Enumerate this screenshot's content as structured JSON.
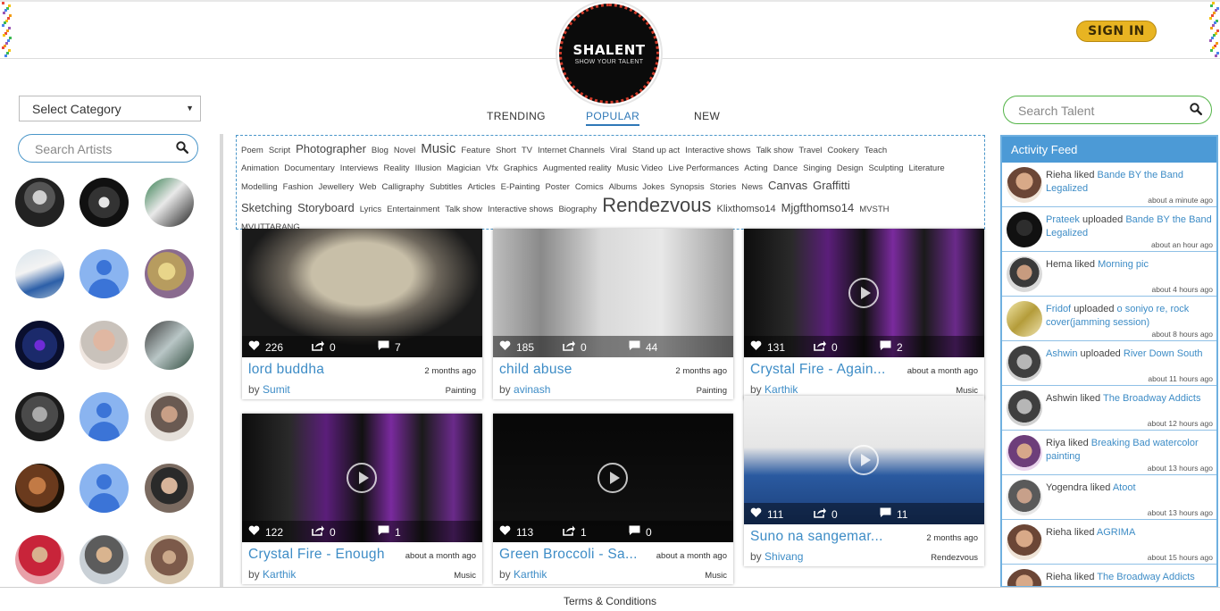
{
  "header": {
    "brand": "SHALENT",
    "tagline": "SHOW YOUR TALENT",
    "signin_label": "SIGN IN"
  },
  "left": {
    "category_select": "Select Category",
    "artist_search_placeholder": "Search Artists"
  },
  "tabs": [
    {
      "label": "TRENDING",
      "active": false
    },
    {
      "label": "POPULAR",
      "active": true
    },
    {
      "label": "NEW",
      "active": false
    }
  ],
  "tags": [
    {
      "t": "Poem",
      "s": 1
    },
    {
      "t": "Script",
      "s": 1
    },
    {
      "t": "Photographer",
      "s": 2
    },
    {
      "t": "Blog",
      "s": 1
    },
    {
      "t": "Novel",
      "s": 1
    },
    {
      "t": "Music",
      "s": 3
    },
    {
      "t": "Feature",
      "s": 1
    },
    {
      "t": "Short",
      "s": 1
    },
    {
      "t": "TV",
      "s": 1
    },
    {
      "t": "Internet Channels",
      "s": 1
    },
    {
      "t": "Viral",
      "s": 1
    },
    {
      "t": "Stand up act",
      "s": 1
    },
    {
      "t": "Interactive shows",
      "s": 1
    },
    {
      "t": "Talk show",
      "s": 1
    },
    {
      "t": "Travel",
      "s": 1
    },
    {
      "t": "Cookery",
      "s": 1
    },
    {
      "t": "Teach",
      "s": 1
    },
    {
      "t": "Animation",
      "s": 1
    },
    {
      "t": "Documentary",
      "s": 1
    },
    {
      "t": "Interviews",
      "s": 1
    },
    {
      "t": "Reality",
      "s": 1
    },
    {
      "t": "Illusion",
      "s": 1
    },
    {
      "t": "Magician",
      "s": 1
    },
    {
      "t": "Vfx",
      "s": 1
    },
    {
      "t": "Graphics",
      "s": 1
    },
    {
      "t": "Augmented reality",
      "s": 1
    },
    {
      "t": "Music Video",
      "s": 1
    },
    {
      "t": "Live Performances",
      "s": 1
    },
    {
      "t": "Acting",
      "s": 1
    },
    {
      "t": "Dance",
      "s": 1
    },
    {
      "t": "Singing",
      "s": 1
    },
    {
      "t": "Design",
      "s": 1
    },
    {
      "t": "Sculpting",
      "s": 1
    },
    {
      "t": "Literature",
      "s": 1
    },
    {
      "t": "Modelling",
      "s": 1
    },
    {
      "t": "Fashion",
      "s": 1
    },
    {
      "t": "Jewellery",
      "s": 1
    },
    {
      "t": "Web",
      "s": 1
    },
    {
      "t": "Calligraphy",
      "s": 1
    },
    {
      "t": "Subtitles",
      "s": 1
    },
    {
      "t": "Articles",
      "s": 1
    },
    {
      "t": "E-Painting",
      "s": 1
    },
    {
      "t": "Poster",
      "s": 1
    },
    {
      "t": "Comics",
      "s": 1
    },
    {
      "t": "Albums",
      "s": 1
    },
    {
      "t": "Jokes",
      "s": 1
    },
    {
      "t": "Synopsis",
      "s": 1
    },
    {
      "t": "Stories",
      "s": 1
    },
    {
      "t": "News",
      "s": 1
    },
    {
      "t": "Canvas",
      "s": 2
    },
    {
      "t": "Graffitti",
      "s": 2
    },
    {
      "t": "Sketching",
      "s": 2
    },
    {
      "t": "Storyboard",
      "s": 2
    },
    {
      "t": "Lyrics",
      "s": 1
    },
    {
      "t": "Entertainment",
      "s": 1
    },
    {
      "t": "Talk show",
      "s": 1
    },
    {
      "t": "Interactive shows",
      "s": 1
    },
    {
      "t": "Biography",
      "s": 1
    },
    {
      "t": "Rendezvous",
      "s": 4
    },
    {
      "t": "Klixthomso14",
      "s": 1.5
    },
    {
      "t": "Mjgfthomso14",
      "s": 2
    },
    {
      "t": "MVSTH",
      "s": 1
    },
    {
      "t": "MVUTTARANG",
      "s": 1
    }
  ],
  "cards": [
    {
      "title": "lord buddha",
      "ago": "2 months ago",
      "by_prefix": "by",
      "author": "Sumit",
      "category": "Painting",
      "likes": "226",
      "shares": "0",
      "comments": "7",
      "video": false,
      "thumb": "buddha"
    },
    {
      "title": "child abuse",
      "ago": "2 months ago",
      "by_prefix": "by",
      "author": "avinash",
      "category": "Painting",
      "likes": "185",
      "shares": "0",
      "comments": "44",
      "video": false,
      "thumb": "childabuse"
    },
    {
      "title": "Crystal Fire - Again...",
      "ago": "about a month ago",
      "by_prefix": "by",
      "author": "Karthik",
      "category": "Music",
      "likes": "131",
      "shares": "0",
      "comments": "2",
      "video": true,
      "thumb": "concert"
    },
    {
      "title": "Crystal Fire - Enough",
      "ago": "about a month ago",
      "by_prefix": "by",
      "author": "Karthik",
      "category": "Music",
      "likes": "122",
      "shares": "0",
      "comments": "1",
      "video": true,
      "thumb": "concert"
    },
    {
      "title": "Green Broccoli - Sa...",
      "ago": "about a month ago",
      "by_prefix": "by",
      "author": "Karthik",
      "category": "Music",
      "likes": "113",
      "shares": "1",
      "comments": "0",
      "video": true,
      "thumb": "dark"
    },
    {
      "title": "Suno na sangemar...",
      "ago": "2 months ago",
      "by_prefix": "by",
      "author": "Shivang",
      "category": "Rendezvous",
      "likes": "111",
      "shares": "0",
      "comments": "11",
      "video": true,
      "thumb": "room"
    }
  ],
  "right": {
    "talent_search_placeholder": "Search Talent",
    "feed_title": "Activity Feed",
    "feed": [
      {
        "user": "Rieha",
        "action": "liked",
        "item": "Bande BY the Band Legalized",
        "time": "about a minute ago",
        "user_link": false
      },
      {
        "user": "Prateek",
        "action": "uploaded",
        "item": "Bande BY the Band Legalized",
        "time": "about an hour ago",
        "user_link": true
      },
      {
        "user": "Hema",
        "action": "liked",
        "item": "Morning pic",
        "time": "about 4 hours ago",
        "user_link": false
      },
      {
        "user": "Fridof",
        "action": "uploaded",
        "item": "o soniyo re, rock cover(jamming session)",
        "time": "about 8 hours ago",
        "user_link": true
      },
      {
        "user": "Ashwin",
        "action": "uploaded",
        "item": "River Down South",
        "time": "about 11 hours ago",
        "user_link": true
      },
      {
        "user": "Ashwin",
        "action": "liked",
        "item": "The Broadway Addicts",
        "time": "about 12 hours ago",
        "user_link": false
      },
      {
        "user": "Riya",
        "action": "liked",
        "item": "Breaking Bad watercolor painting",
        "time": "about 13 hours ago",
        "user_link": false
      },
      {
        "user": "Yogendra",
        "action": "liked",
        "item": "Atoot",
        "time": "about 13 hours ago",
        "user_link": false
      },
      {
        "user": "Rieha",
        "action": "liked",
        "item": "AGRIMA",
        "time": "about 15 hours ago",
        "user_link": false
      },
      {
        "user": "Rieha",
        "action": "liked",
        "item": "The Broadway Addicts",
        "time": "",
        "user_link": false
      }
    ]
  },
  "footer": {
    "terms": "Terms & Conditions"
  }
}
